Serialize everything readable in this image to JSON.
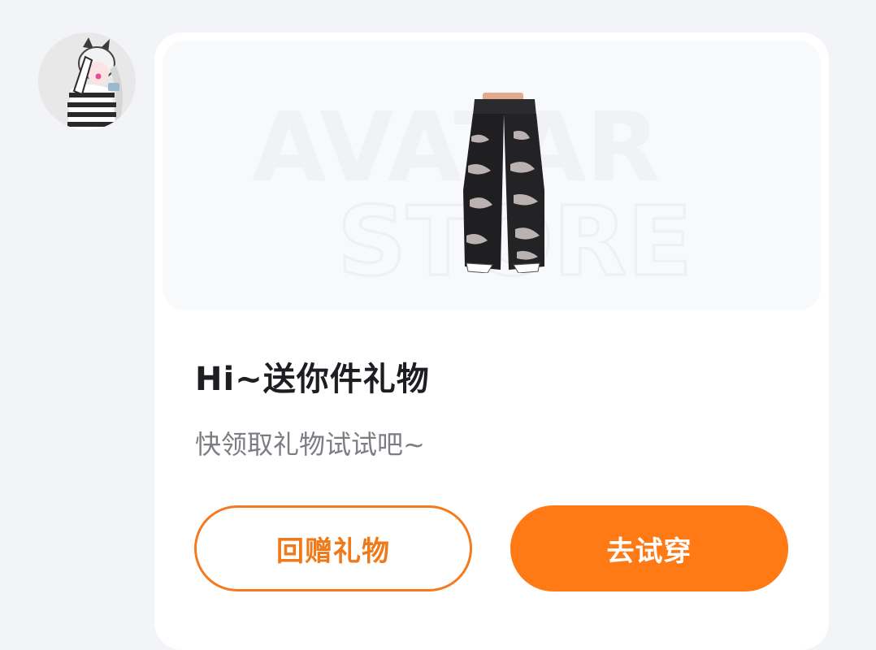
{
  "sender": {
    "avatar_icon": "avatar-icon"
  },
  "gift_card": {
    "preview": {
      "watermark_line1": "AVATAR",
      "watermark_line2": "STORE",
      "product_icon": "ripped-jeans-icon"
    },
    "title": "Hi~送你件礼物",
    "subtitle": "快领取礼物试试吧~",
    "buttons": {
      "return_gift_label": "回赠礼物",
      "try_on_label": "去试穿"
    }
  },
  "colors": {
    "accent": "#ff7a14",
    "background": "#f3f4f8",
    "card": "#ffffff",
    "title": "#1e1e22",
    "subtitle": "#7c7d83"
  }
}
